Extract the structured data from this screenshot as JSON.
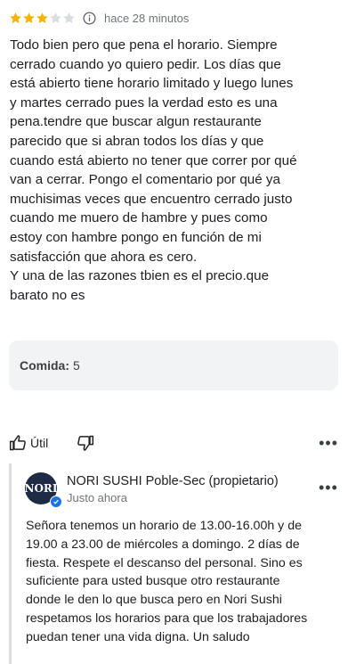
{
  "review": {
    "rating": 3,
    "rating_max": 5,
    "time_ago": "hace 28 minutos",
    "text": "Todo bien pero que pena el horario. Siempre\ncerrado cuando yo quiero pedir. Los días que\nestá abierto tiene horario limitado y luego lunes\ny martes cerrado pues la verdad esto es una\npena.tendre que buscar algun restaurante\nparecido que si abran todos los días y que\ncuando está abierto no tener que correr por qué\nvan a cerrar. Pongo el comentario por qué ya\nmuchisimas veces que encuentro cerrado justo\ncuando me muero de hambre y pues como\nestoy con hambre pongo en función de mi\nsatisfacción que ahora es cero.\nY una de las razones tbien es el precio.que\nbarato no es",
    "food_label": "Comida:",
    "food_value": "5",
    "helpful_label": "Útil",
    "more": "•••",
    "colors": {
      "star_filled": "#f4b400",
      "star_empty": "#dadce0"
    }
  },
  "owner_reply": {
    "avatar_text": "NORI",
    "name": "NORI SUSHI Poble-Sec (propietario)",
    "time": "Justo ahora",
    "more": "•••",
    "text": "Señora tenemos un horario de 13.00-16.00h y de\n19.00 a 23.00 de miércoles a domingo. 2 días de\nfiesta. Respete el descanso del personal. Sino es\nsuficiente para usted busque otro restaurante\ndonde le den lo que busca pero en Nori Sushi\nrespetamos los horarios para que los trabajadores\npuedan tener una vida digna. Un saludo"
  },
  "icons": {
    "star": "star-icon",
    "info": "info-icon",
    "like": "thumbs-up-icon",
    "dislike": "thumbs-down-icon",
    "verified": "verified-check-icon"
  }
}
